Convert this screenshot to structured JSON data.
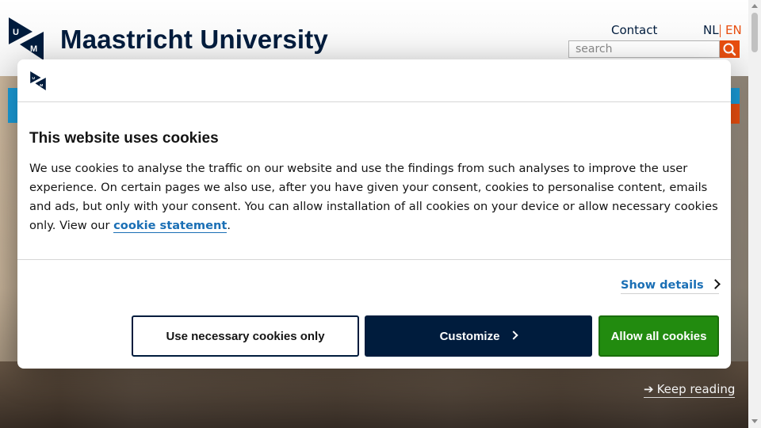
{
  "header": {
    "brand": "Maastricht University",
    "contact": "Contact",
    "lang_nl": "NL",
    "lang_en": "EN",
    "search_placeholder": "search",
    "search_icon": "search-icon"
  },
  "hero": {
    "keep_reading": "Keep reading"
  },
  "cookie_dialog": {
    "title": "This website uses cookies",
    "body_before_link": "We use cookies to analyse the traffic on our website and use the findings from such analyses to improve the user experience. On certain pages we also use, after you have given your consent, cookies to personalise content, emails and ads, but only with your consent. You can allow installation of all cookies on your device or allow necessary cookies only. View our ",
    "link_text": "cookie statement",
    "body_after_link": ".",
    "show_details": "Show details",
    "btn_necessary": "Use necessary cookies only",
    "btn_customize": "Customize",
    "btn_allow_all": "Allow all cookies"
  },
  "colors": {
    "brand_navy": "#001c3d",
    "accent_orange": "#e84e0f",
    "link_blue": "#1a6fb5",
    "allow_green": "#228b0f"
  }
}
